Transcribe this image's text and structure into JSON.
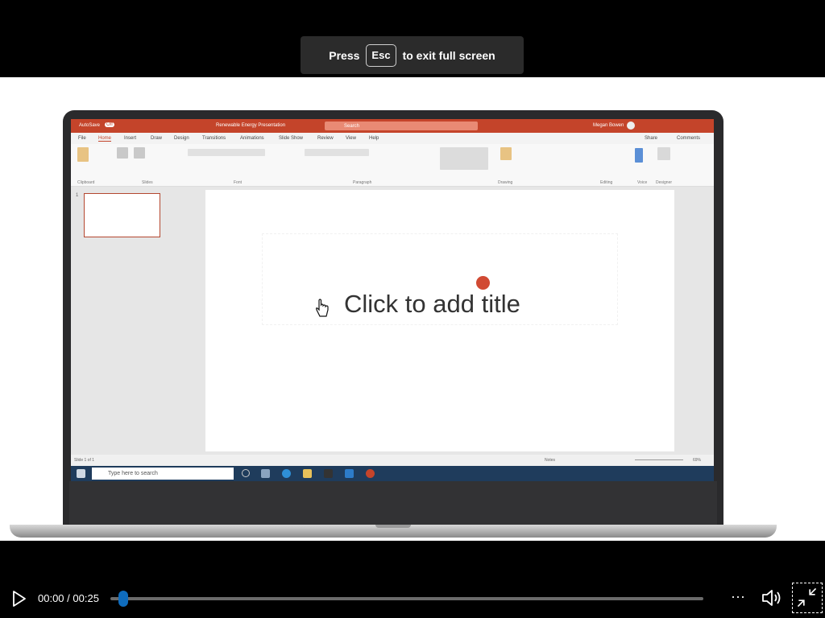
{
  "banner": {
    "press": "Press",
    "key": "Esc",
    "suffix": "to exit full screen"
  },
  "powerpoint": {
    "autosave": "AutoSave",
    "toggle": "Off",
    "doc_title": "Renewable Energy Presentation",
    "search": "Search",
    "user": "Megan Bowen",
    "menu": [
      "File",
      "Home",
      "Insert",
      "Draw",
      "Design",
      "Transitions",
      "Animations",
      "Slide Show",
      "Review",
      "View",
      "Help"
    ],
    "share": "Share",
    "comments": "Comments",
    "ribbon_groups": [
      "Clipboard",
      "Slides",
      "Font",
      "Paragraph",
      "Drawing",
      "Editing",
      "Voice",
      "Designer"
    ],
    "slide_number": "1",
    "title_placeholder": "Click to add title",
    "status_left": "Slide 1 of 1",
    "status_notes": "Notes",
    "zoom": "69%",
    "taskbar_search": "Type here to search"
  },
  "player": {
    "current_time": "00:00",
    "total_time": "00:25",
    "separator": "/",
    "progress": 0.0,
    "more_label": "···",
    "accent": "#0f6cbd"
  }
}
